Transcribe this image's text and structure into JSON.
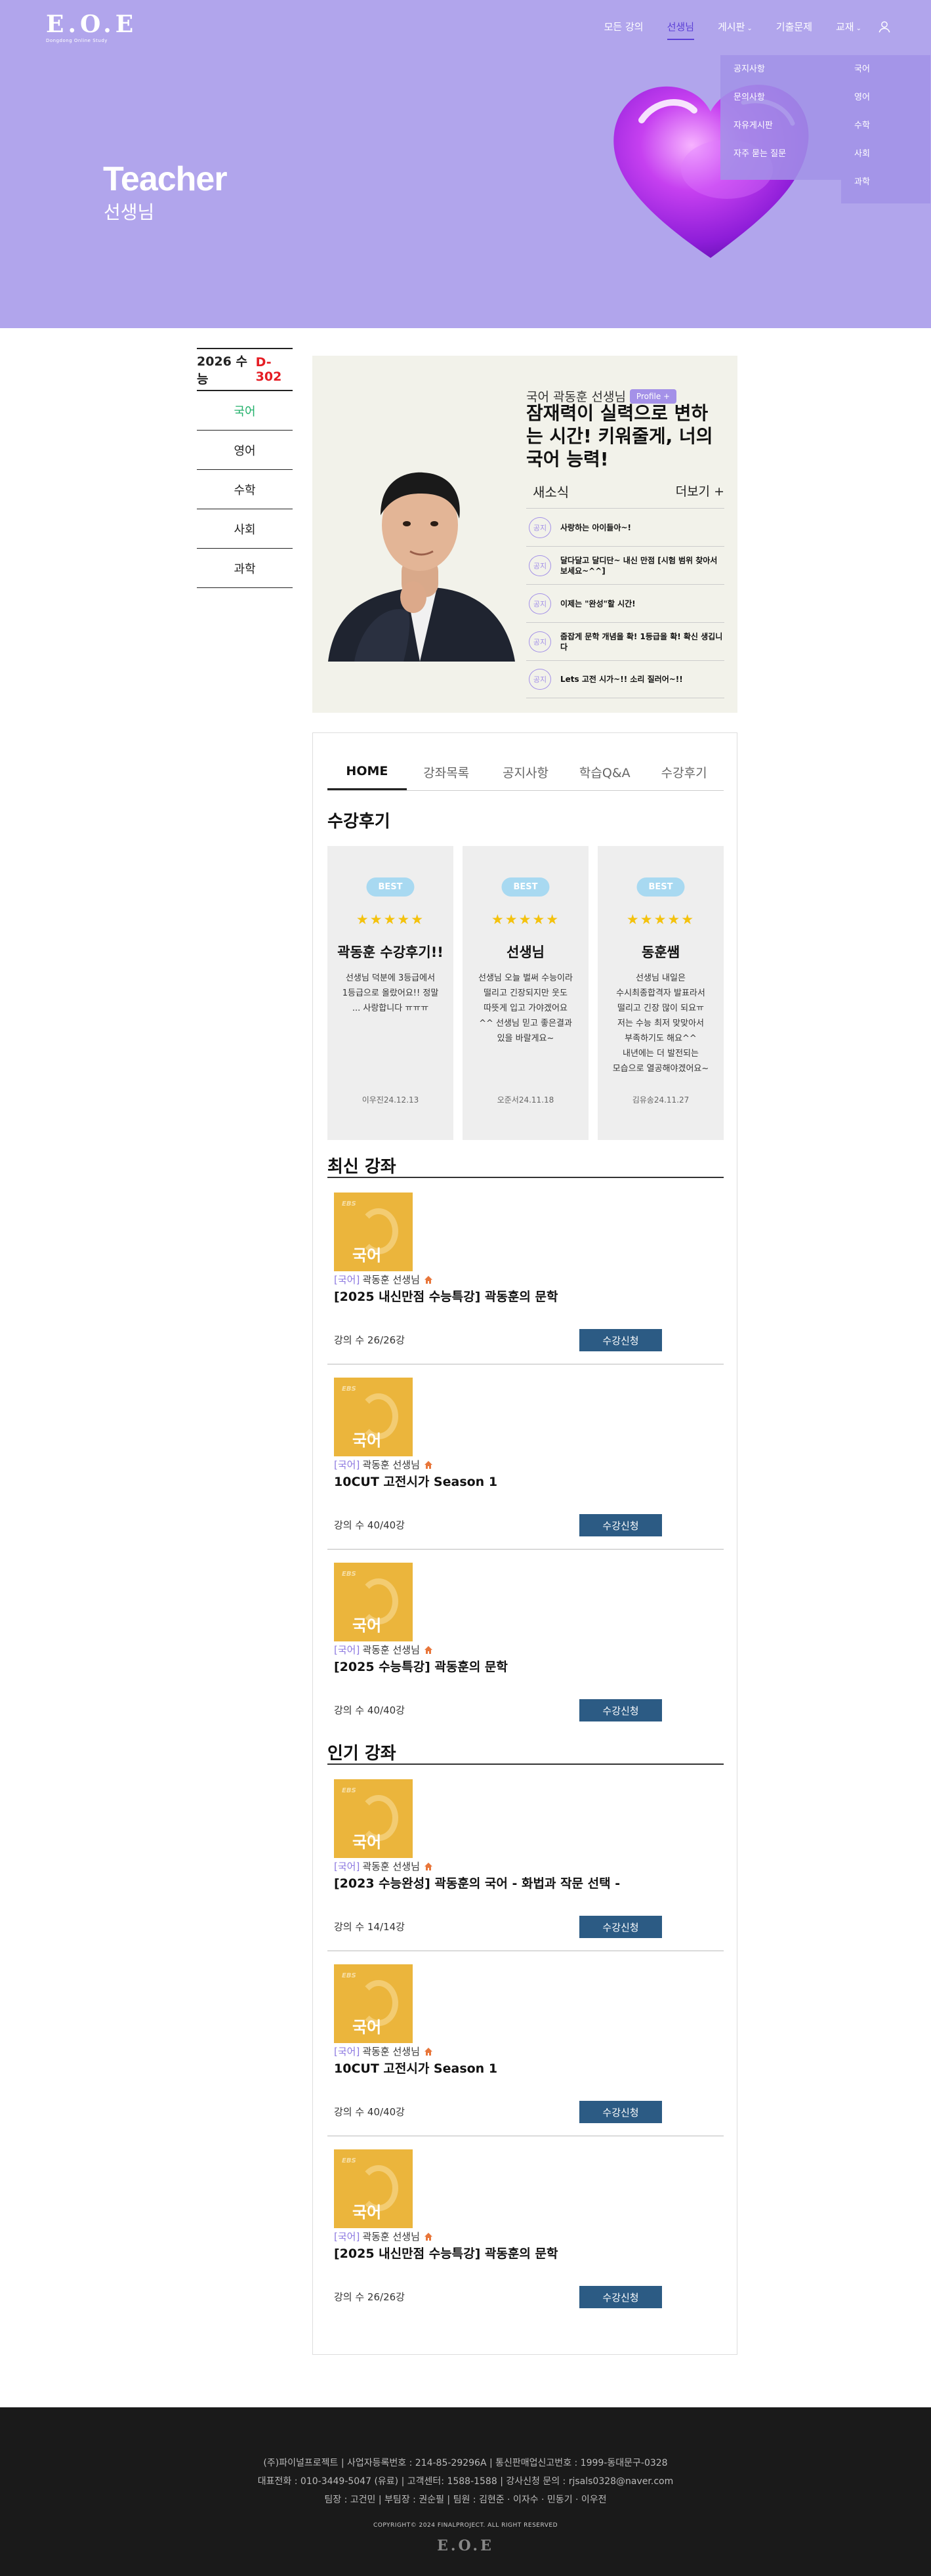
{
  "brand": {
    "logo_mark": "E.O.E",
    "logo_sub": "Dongdong Online Study"
  },
  "nav": {
    "items": [
      {
        "label": "모든 강의"
      },
      {
        "label": "선생님"
      },
      {
        "label": "게시판"
      },
      {
        "label": "기출문제"
      },
      {
        "label": "교재"
      }
    ]
  },
  "dropdown_board": [
    "공지사항",
    "문의사항",
    "자유게시판",
    "자주 묻는 질문"
  ],
  "dropdown_books": [
    "국어",
    "영어",
    "수학",
    "사회",
    "과학"
  ],
  "hero": {
    "title": "Teacher",
    "subtitle": "선생님"
  },
  "sidebar": {
    "head_prefix": "2026 수능",
    "dday": "D-302",
    "items": [
      {
        "label": "국어"
      },
      {
        "label": "영어"
      },
      {
        "label": "수학"
      },
      {
        "label": "사회"
      },
      {
        "label": "과학"
      }
    ]
  },
  "profile": {
    "line": "국어 곽동훈 선생님",
    "button": "Profile +",
    "quote": "잠재력이 실력으로 변하는 시간! 키워줄게, 너의 국어 능력!",
    "news_title": "새소식",
    "news_more": "더보기 +",
    "news": [
      {
        "tag": "공지",
        "text": "사랑하는 아이들아~!"
      },
      {
        "tag": "공지",
        "text": "달다달고 달디단~ 내신 만점 [시험 범위 찾아서 보세요~^^]"
      },
      {
        "tag": "공지",
        "text": "이제는 \"완성\"할 시간!"
      },
      {
        "tag": "공지",
        "text": "줍잡게 문학 개념을 확! 1등급을 확! 확신 생깁니다"
      },
      {
        "tag": "공지",
        "text": "Lets 고전 시가~!! 소리 질러어~!!"
      }
    ]
  },
  "tabs": [
    {
      "label": "HOME"
    },
    {
      "label": "강좌목록"
    },
    {
      "label": "공지사항"
    },
    {
      "label": "학습Q&A"
    },
    {
      "label": "수강후기"
    }
  ],
  "reviews_title": "수강후기",
  "reviews": [
    {
      "badge": "BEST",
      "stars": "★★★★★",
      "title": "곽동훈 수강후기!!",
      "body": "선생님 덕분에 3등급에서 1등급으로 올랐어요!! 정말 ... 사랑합니다 ㅠㅠㅠ",
      "meta": "이우진24.12.13"
    },
    {
      "badge": "BEST",
      "stars": "★★★★★",
      "title": "선생님",
      "body": "선생님 오늘 벌써 수능이라 떨리고 긴장되지만 웃도 따뜻게 입고 가야겠어요 ^^ 선생님 믿고 좋은결과 있을 바랄게요~",
      "meta": "오준서24.11.18"
    },
    {
      "badge": "BEST",
      "stars": "★★★★★",
      "title": "동훈쌤",
      "body": "선생님 내일은 수시최종합격자 발표라서 떨리고 긴장 많이 되요ㅠ 저는 수능 최저 맞맞아서 부족하기도 해요^^ 내년에는 더 발전되는 모습으로 열공해야겠어요~",
      "meta": "김유송24.11.27"
    }
  ],
  "latest_title": "최신 강좌",
  "popular_title": "인기 강좌",
  "thumb": {
    "ebs": "EBS",
    "word": "국어"
  },
  "latest": [
    {
      "cat": "[국어]",
      "teacher": "곽동훈 선생님",
      "title": "[2025 내신만점 수능특강] 곽동훈의 문학",
      "count": "강의 수 26/26강",
      "button": "수강신청"
    },
    {
      "cat": "[국어]",
      "teacher": "곽동훈 선생님",
      "title": "10CUT 고전시가 Season 1",
      "count": "강의 수 40/40강",
      "button": "수강신청"
    },
    {
      "cat": "[국어]",
      "teacher": "곽동훈 선생님",
      "title": "[2025 수능특강] 곽동훈의 문학",
      "count": "강의 수 40/40강",
      "button": "수강신청"
    }
  ],
  "popular": [
    {
      "cat": "[국어]",
      "teacher": "곽동훈 선생님",
      "title": "[2023 수능완성] 곽동훈의 국어 - 화법과 작문 선택 -",
      "count": "강의 수 14/14강",
      "button": "수강신청"
    },
    {
      "cat": "[국어]",
      "teacher": "곽동훈 선생님",
      "title": "10CUT 고전시가 Season 1",
      "count": "강의 수 40/40강",
      "button": "수강신청"
    },
    {
      "cat": "[국어]",
      "teacher": "곽동훈 선생님",
      "title": "[2025 내신만점 수능특강] 곽동훈의 문학",
      "count": "강의 수 26/26강",
      "button": "수강신청"
    }
  ],
  "footer": {
    "line1": "(주)파이널프로젝트 | 사업자등록번호 : 214-85-29296A | 통신판매업신고번호 : 1999-동대문구-0328",
    "line2": "대표전화 : 010-3449-5047 (유료) | 고객센터: 1588-1588 | 강사신청 문의 : rjsals0328@naver.com",
    "line3": "팀장 : 고건민  |  부팀장 : 권순필  |  팀원 : 김현준 · 이자수 · 민동기 · 이우전",
    "copyright": "COPYRIGHT© 2024 FINALPROJECT. ALL RIGHT RESERVED",
    "logo": "E.O.E"
  },
  "colors": {
    "hero_bg": "#b1a5ec",
    "accent_purple": "#5b3fd6",
    "active_green": "#21b06a",
    "dday_red": "#e51c23",
    "button_navy": "#2c5b84",
    "thumb_yellow": "#ebb53c"
  }
}
